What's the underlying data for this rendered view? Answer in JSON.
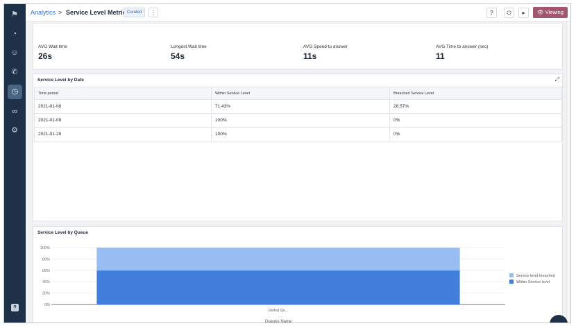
{
  "header": {
    "breadcrumb_root": "Analytics",
    "separator": ">",
    "title": "Service Level Metrics",
    "badge": "Curated",
    "viewing_label": "Viewing"
  },
  "stats": [
    {
      "label": "AVG Wait time",
      "value": "26s"
    },
    {
      "label": "Longest Wait time",
      "value": "54s"
    },
    {
      "label": "AVG Speed to answer",
      "value": "11s"
    },
    {
      "label": "AVG Time to answer (sec)",
      "value": "11"
    }
  ],
  "table": {
    "title": "Service Level by Date",
    "columns": [
      "Time period",
      "Within Service Level",
      "Breached Service Level"
    ],
    "rows": [
      [
        "2021-01-08",
        "71.43%",
        "28.57%"
      ],
      [
        "2021-01-09",
        "100%",
        "0%"
      ],
      [
        "2021-01-29",
        "100%",
        "0%"
      ]
    ]
  },
  "chart_data": {
    "type": "bar",
    "stacked": true,
    "title": "Service Level by Queue",
    "xlabel": "Queues Name",
    "ylabel": "",
    "categories": [
      "Global Qu..."
    ],
    "series": [
      {
        "name": "Within Service level",
        "values": [
          60
        ],
        "color": "#427fdc"
      },
      {
        "name": "Service level breached",
        "values": [
          40
        ],
        "color": "#97bdf2"
      }
    ],
    "yticks": [
      "0%",
      "20%",
      "40%",
      "60%",
      "80%",
      "100%"
    ],
    "ylim": [
      0,
      100
    ],
    "legend": "right",
    "grid": true
  },
  "colors": {
    "sidebar": "#1f3148",
    "accent": "#a15670"
  }
}
